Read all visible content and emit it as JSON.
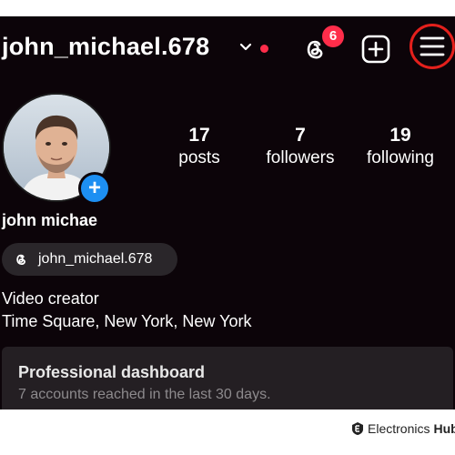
{
  "header": {
    "username": "john_michael.678",
    "notification_count": "6"
  },
  "profile": {
    "stats": [
      {
        "value": "17",
        "label": "posts"
      },
      {
        "value": "7",
        "label": "followers"
      },
      {
        "value": "19",
        "label": "following"
      }
    ],
    "display_name": "john michae",
    "threads_handle": "john_michael.678",
    "bio": [
      "Video creator",
      "Time Square, New York, New York"
    ]
  },
  "dashboard": {
    "title": "Professional dashboard",
    "subtitle": "7 accounts reached in the last 30 days."
  },
  "watermark": {
    "brand_main": "Electronics",
    "brand_bold": "Hub"
  },
  "colors": {
    "background": "#0c0409",
    "accent_red": "#ff2d4a",
    "highlight_circle": "#e4201c",
    "add_blue": "#1d8ff2"
  },
  "icons": [
    "chevron-down-icon",
    "threads-icon",
    "add-post-icon",
    "hamburger-menu-icon",
    "plus-icon"
  ]
}
